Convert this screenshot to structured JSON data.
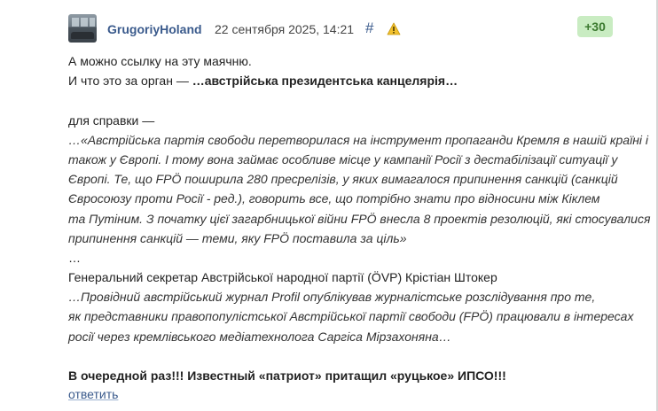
{
  "comment": {
    "author": "GrugoriyHoland",
    "date": "22 сентября 2025, 14:21",
    "permalink_symbol": "#",
    "score": "+30",
    "reply_label": "ответить",
    "lines": {
      "l1": "А можно ссылку на эту маячню.",
      "l2_prefix": "И что это за орган — ",
      "l2_bold": "…австрійська президентська канцелярія…",
      "l3": "для справки —",
      "q1": "…«Австрійська партія свободи перетворилася на інструмент пропаганди Кремля в нашій країні і",
      "q2": "також у Європі. І тому вона займає особливе місце у кампанії Росії з дестабілізації ситуації у",
      "q3": "Європі. Те, що FPÖ поширила 280 пресрелізів, у яких вимагалося припинення санкцій (санкцій",
      "q4": "Євросоюзу проти Росії - ред.), говорить все, що потрібно знати про відносини між Кіклем",
      "q5": "та Путіним. З початку цієї загарбницької війни FPÖ внесла 8 проектів резолюцій, які стосувалися",
      "q6": "припинення санкцій — теми, яку FPÖ поставила за ціль»",
      "ellipsis": "…",
      "attribution": "Генеральний секретар Австрійської народної партії (ÖVP) Крістіан Штокер",
      "p1": "…Провідний австрійський журнал Profil опублікував журналістське розслідування про те,",
      "p2": "як представники правопопулістської Австрійської партії свободи (FPÖ) працювали в інтересах",
      "p3": "росії через кремлівського медіатехнолога Саргіса Мірзахоняна…",
      "final": "В очередной раз!!! Известный «патриот» притащил «руцькое» ИПСО!!!"
    }
  },
  "colors": {
    "link": "#3a5a8c",
    "score_bg": "#c9ecc2",
    "score_text": "#3c7a30",
    "warning": "#f2c12e"
  },
  "icons": {
    "avatar": "user-avatar-photo",
    "warning": "warning-triangle-icon"
  }
}
